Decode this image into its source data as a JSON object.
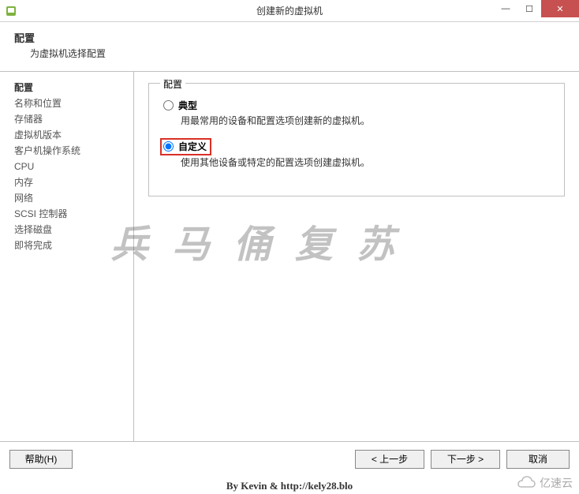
{
  "titlebar": {
    "title": "创建新的虚拟机"
  },
  "header": {
    "title": "配置",
    "subtitle": "为虚拟机选择配置"
  },
  "sidebar": {
    "items": [
      {
        "label": "配置",
        "active": true
      },
      {
        "label": "名称和位置",
        "active": false
      },
      {
        "label": "存储器",
        "active": false
      },
      {
        "label": "虚拟机版本",
        "active": false
      },
      {
        "label": "客户机操作系统",
        "active": false
      },
      {
        "label": "CPU",
        "active": false
      },
      {
        "label": "内存",
        "active": false
      },
      {
        "label": "网络",
        "active": false
      },
      {
        "label": "SCSI 控制器",
        "active": false
      },
      {
        "label": "选择磁盘",
        "active": false
      },
      {
        "label": "即将完成",
        "active": false
      }
    ]
  },
  "content": {
    "legend": "配置",
    "options": [
      {
        "label": "典型",
        "desc": "用最常用的设备和配置选项创建新的虚拟机。",
        "checked": false,
        "highlighted": false
      },
      {
        "label": "自定义",
        "desc": "使用其他设备或特定的配置选项创建虚拟机。",
        "checked": true,
        "highlighted": true
      }
    ]
  },
  "footer": {
    "help": "帮助(H)",
    "back": "< 上一步",
    "next": "下一步 >",
    "cancel": "取消"
  },
  "watermark": "兵马俑复苏",
  "attribution": "By Kevin & http://kely28.blo",
  "corner_logo": "亿速云"
}
